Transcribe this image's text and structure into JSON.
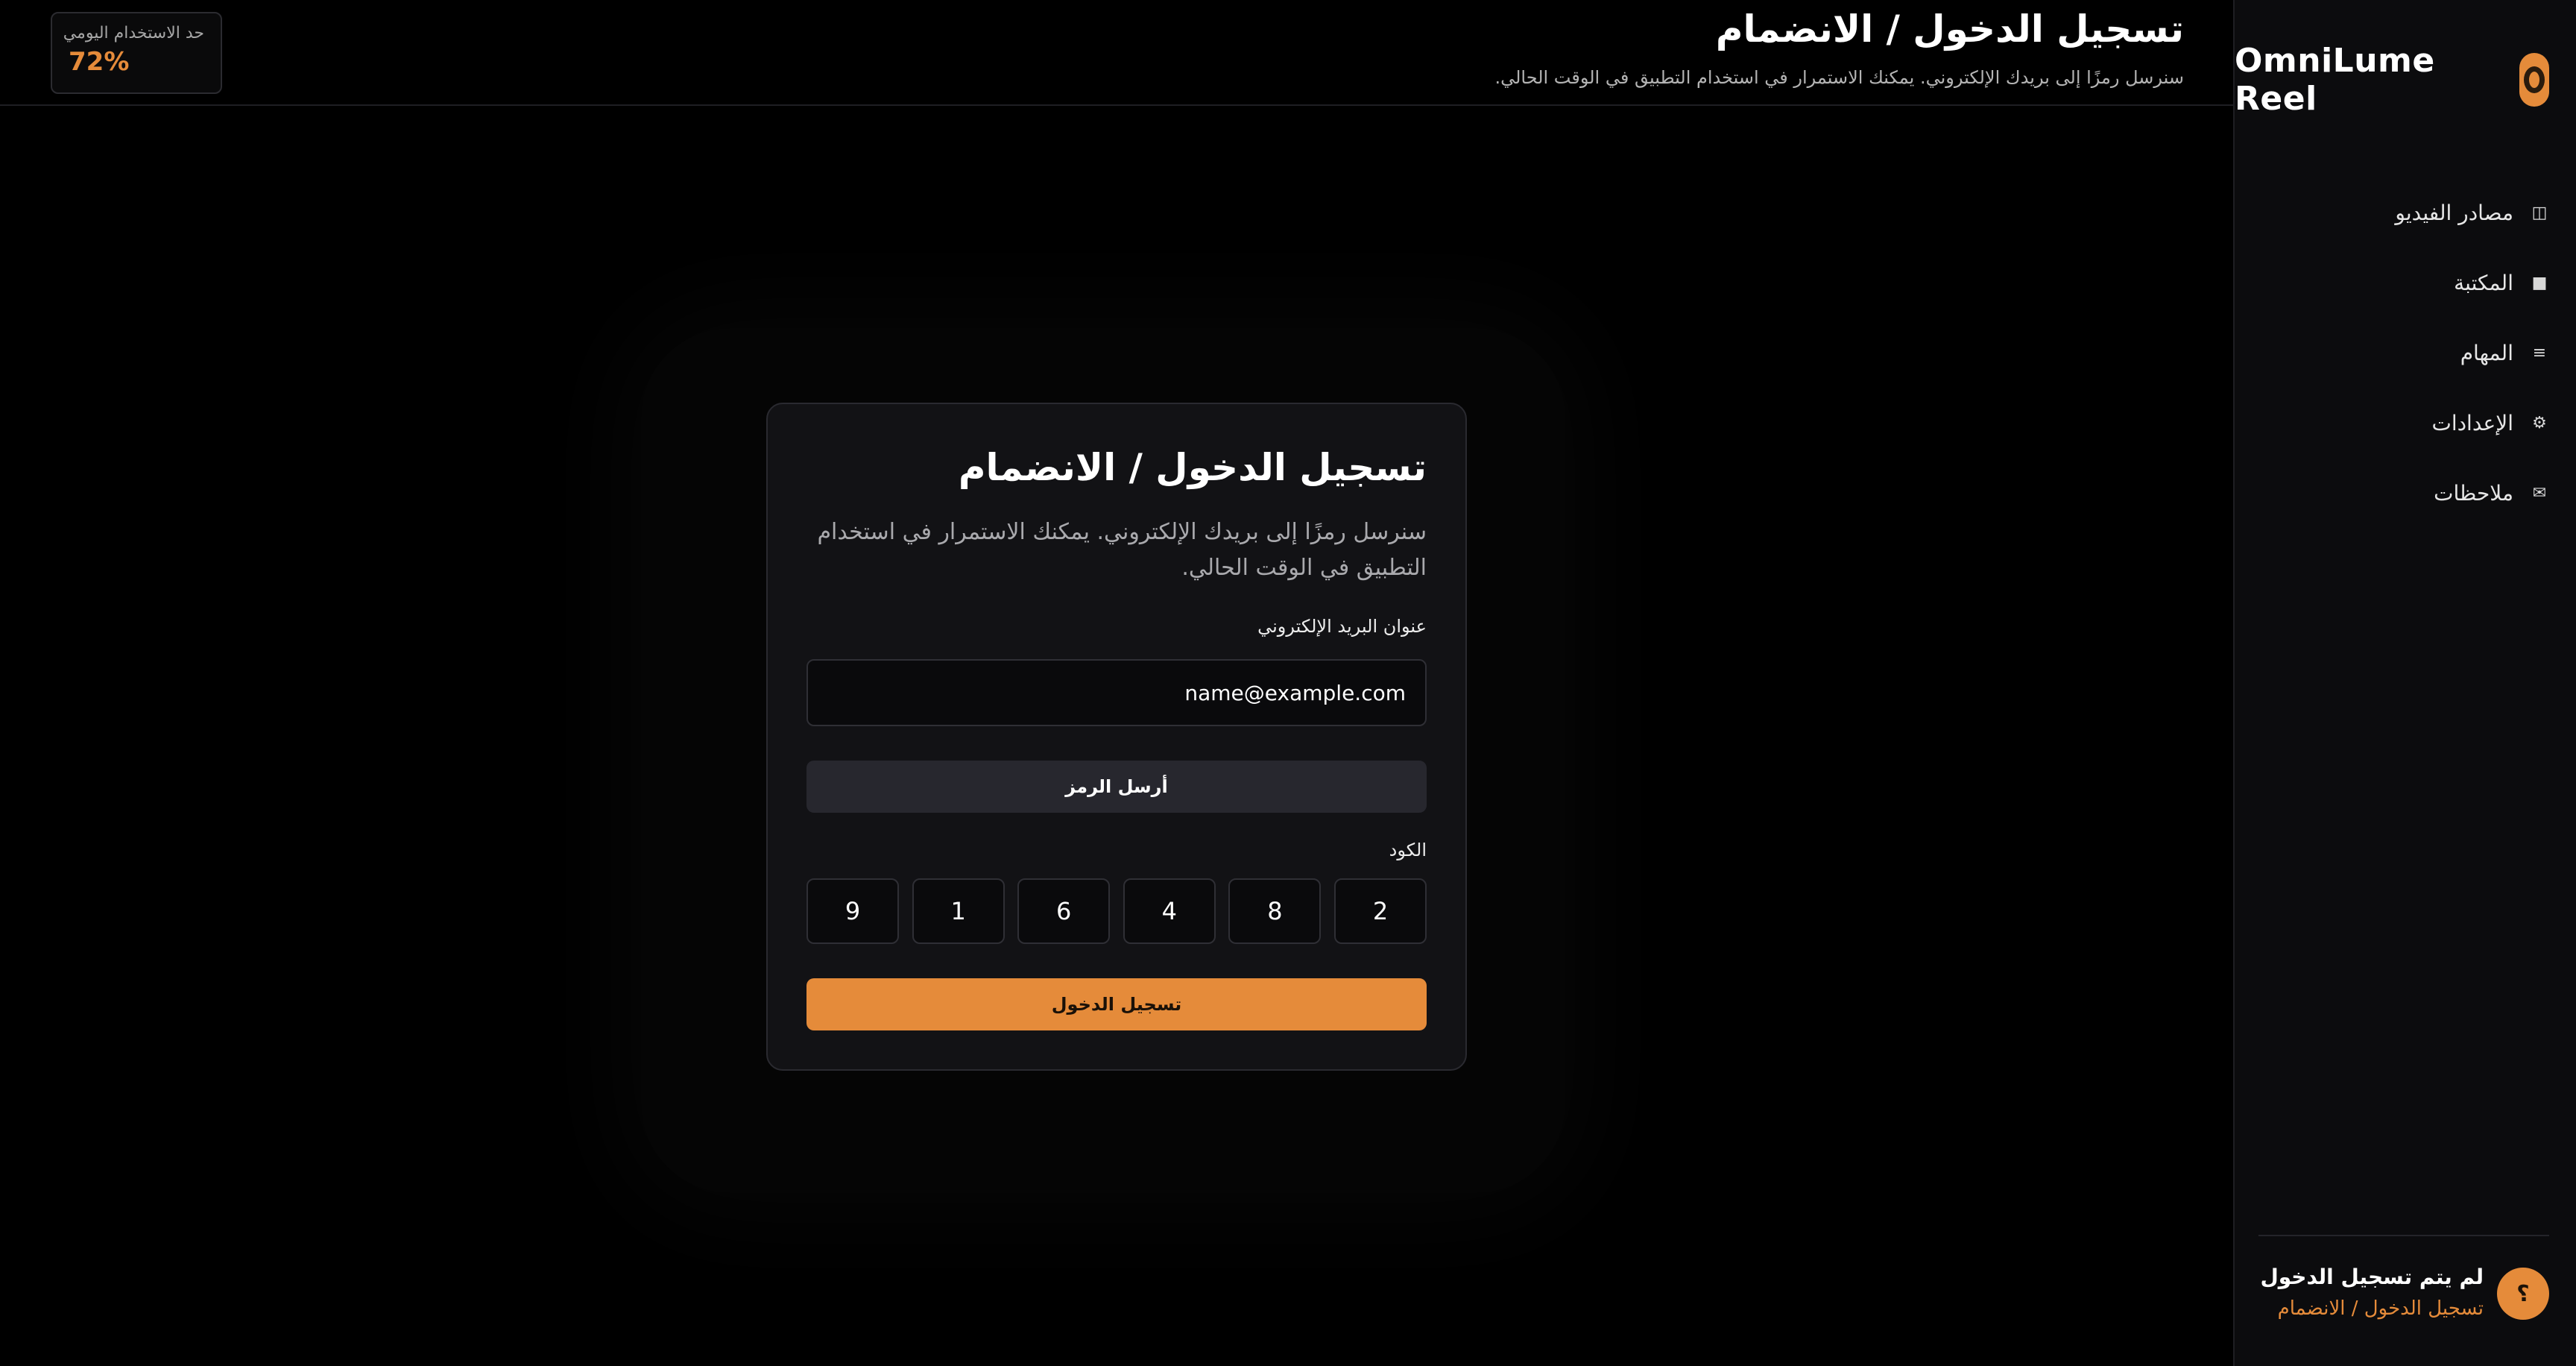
{
  "app": {
    "name": "OmniLume Reel"
  },
  "sidebar": {
    "items": [
      {
        "label": "مصادر الفيديو",
        "icon": "columns-icon"
      },
      {
        "label": "المكتبة",
        "icon": "square-icon"
      },
      {
        "label": "المهام",
        "icon": "list-icon"
      },
      {
        "label": "الإعدادات",
        "icon": "gear-icon"
      },
      {
        "label": "ملاحظات",
        "icon": "envelope-icon"
      }
    ],
    "icons": [
      "◫",
      "■",
      "≡",
      "⚙",
      "✉"
    ],
    "user": {
      "avatar": "؟",
      "status": "لم يتم تسجيل الدخول",
      "action": "تسجيل الدخول / الانضمام"
    }
  },
  "header": {
    "title": "تسجيل الدخول / الانضمام",
    "subtitle": "سنرسل رمزًا إلى بريدك الإلكتروني. يمكنك الاستمرار في استخدام التطبيق في الوقت الحالي.",
    "usage": {
      "label": "حد الاستخدام اليومي",
      "value": "72%"
    }
  },
  "login_card": {
    "title": "تسجيل الدخول / الانضمام",
    "description": "سنرسل رمزًا إلى بريدك الإلكتروني. يمكنك الاستمرار في استخدام التطبيق في الوقت الحالي.",
    "email_label": "عنوان البريد الإلكتروني",
    "email_value": "name@example.com",
    "send_button": "أرسل الرمز",
    "code_label": "الكود",
    "code_digits": [
      "2",
      "8",
      "4",
      "6",
      "1",
      "9"
    ],
    "submit_button": "تسجيل الدخول"
  },
  "colors": {
    "accent": "#e58b3a",
    "background": "#000000",
    "sidebar": "#0c0c0e",
    "card": "#121215"
  }
}
